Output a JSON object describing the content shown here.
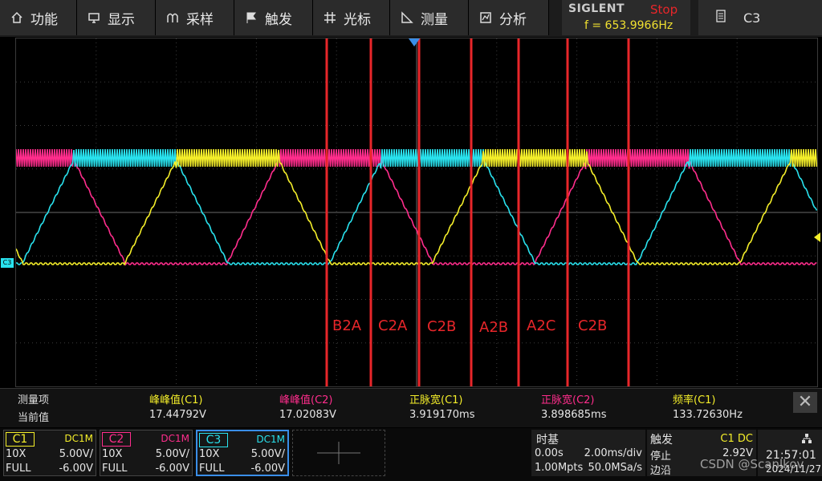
{
  "menu": [
    {
      "label": "功能",
      "icon": "home-icon"
    },
    {
      "label": "显示",
      "icon": "display-icon"
    },
    {
      "label": "采样",
      "icon": "sample-icon"
    },
    {
      "label": "触发",
      "icon": "flag-icon"
    },
    {
      "label": "光标",
      "icon": "cursor-icon"
    },
    {
      "label": "测量",
      "icon": "measure-icon"
    },
    {
      "label": "分析",
      "icon": "analysis-icon"
    }
  ],
  "brand": "SIGLENT",
  "run_status": "Stop",
  "frequency_readout": "f = 653.9966Hz",
  "source_channel": "C3",
  "colors": {
    "c1": "#f4ee2a",
    "c2": "#ff2d8c",
    "c3": "#29e2ee",
    "annot": "#e8262a"
  },
  "annotations": [
    "B2A",
    "C2A",
    "C2B",
    "A2B",
    "A2C",
    "C2B"
  ],
  "channel_marker": "C3",
  "measurements": {
    "header_label": "测量项",
    "value_label": "当前值",
    "items": [
      {
        "name": "峰峰值(C1)",
        "value": "17.44792V",
        "color": "#f4ee2a"
      },
      {
        "name": "峰峰值(C2)",
        "value": "17.02083V",
        "color": "#ff2d8c"
      },
      {
        "name": "正脉宽(C1)",
        "value": "3.919170ms",
        "color": "#f4ee2a"
      },
      {
        "name": "正脉宽(C2)",
        "value": "3.898685ms",
        "color": "#ff2d8c"
      },
      {
        "name": "频率(C1)",
        "value": "133.72630Hz",
        "color": "#f4ee2a"
      }
    ]
  },
  "channels": [
    {
      "name": "C1",
      "coupling": "DC1M",
      "probe": "10X",
      "scale": "5.00V/",
      "bw": "FULL",
      "offset": "-6.00V",
      "color": "#f4ee2a"
    },
    {
      "name": "C2",
      "coupling": "DC1M",
      "probe": "10X",
      "scale": "5.00V/",
      "bw": "FULL",
      "offset": "-6.00V",
      "color": "#ff2d8c"
    },
    {
      "name": "C3",
      "coupling": "DC1M",
      "probe": "10X",
      "scale": "5.00V/",
      "bw": "FULL",
      "offset": "-6.00V",
      "color": "#29e2ee"
    }
  ],
  "timebase": {
    "title": "时基",
    "delay": "0.00s",
    "scale": "2.00ms/div",
    "points": "1.00Mpts",
    "rate": "50.0MSa/s"
  },
  "trigger": {
    "title": "触发",
    "source": "C1 DC",
    "mode": "停止",
    "level": "2.92V",
    "slope": "边沿"
  },
  "clock": {
    "time": "21:57:01",
    "date": "2024/11/27"
  },
  "watermark": "CSDN @Scanlkov"
}
